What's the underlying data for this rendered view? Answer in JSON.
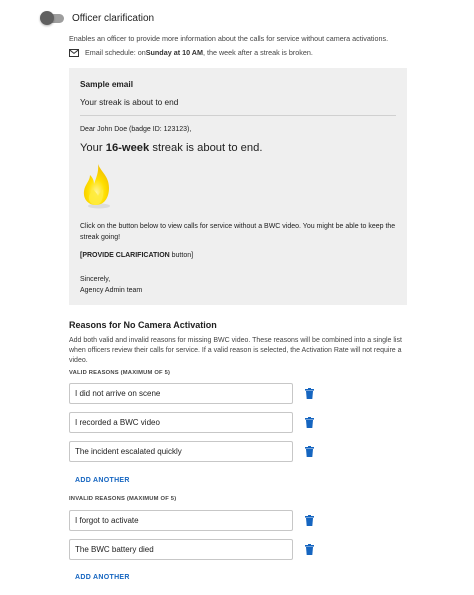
{
  "toggle": {
    "label": "Officer clarification",
    "enabled": false
  },
  "description": "Enables an officer to provide more information about the calls for service without camera activations.",
  "email_schedule": {
    "prefix": "Email schedule: on ",
    "day_time": "Sunday at 10 AM",
    "suffix": ", the week after a streak is broken.",
    "icon": "envelope-icon"
  },
  "sample_email": {
    "title": "Sample email",
    "subject": "Your streak is about to end",
    "greeting": "Dear John Doe (badge ID: 123123),",
    "streak_prefix": "Your ",
    "streak_bold": "16-week",
    "streak_suffix": " streak is about to end.",
    "flame_icon": "flame-icon",
    "body": "Click on the button below to view calls for service without a BWC video. You might be able to keep the streak going!",
    "button_bold": "[PROVIDE CLARIFICATION",
    "button_suffix": " button]",
    "signoff": "Sincerely,",
    "signature": "Agency Admin team"
  },
  "reasons": {
    "title": "Reasons for No Camera Activation",
    "description": "Add both valid and invalid reasons for missing BWC video. These reasons will be combined into a single list when officers review their calls for service. If a valid reason is selected, the Activation Rate will not require a video.",
    "valid_label": "VALID REASONS (MAXIMUM OF 5)",
    "valid": [
      "I did not arrive on scene",
      "I recorded a BWC video",
      "The incident escalated quickly"
    ],
    "invalid_label": "INVALID REASONS (MAXIMUM OF 5)",
    "invalid": [
      "I forgot to activate",
      "The BWC battery died"
    ],
    "add_label": "ADD ANOTHER"
  },
  "colors": {
    "accent": "#1565c0",
    "trash": "#1565c0",
    "panel": "#efefef",
    "flame": "#ffd600"
  }
}
